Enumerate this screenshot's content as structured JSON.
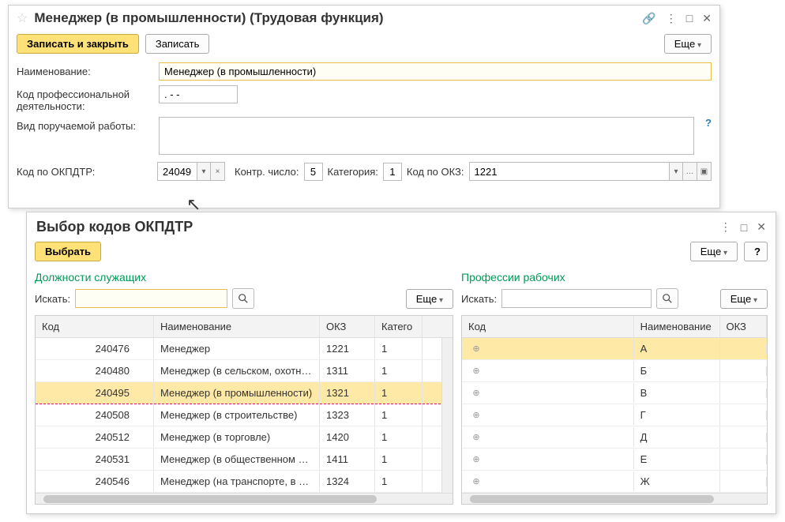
{
  "win1": {
    "title": "Менеджер (в промышленности) (Трудовая функция)",
    "toolbar": {
      "save_close": "Записать и закрыть",
      "save": "Записать",
      "more": "Еще"
    },
    "labels": {
      "name": "Наименование:",
      "code_prof": "Код профессиональной деятельности:",
      "work_type": "Вид поручаемой работы:",
      "okpdtr": "Код по ОКПДТР:",
      "check_num": "Контр. число:",
      "category": "Категория:",
      "okz": "Код по ОКЗ:"
    },
    "values": {
      "name": "Менеджер (в промышленности)",
      "code_prof": ". - -",
      "okpdtr": "24049",
      "check_num": "5",
      "category": "1",
      "okz": "1221"
    }
  },
  "win2": {
    "title": "Выбор кодов ОКПДТР",
    "toolbar": {
      "select": "Выбрать",
      "more": "Еще",
      "help": "?"
    },
    "left": {
      "title": "Должности служащих",
      "search_label": "Искать:",
      "more": "Еще",
      "columns": {
        "code": "Код",
        "name": "Наименование",
        "okz": "ОКЗ",
        "cat": "Катего"
      },
      "rows": [
        {
          "code": "240476",
          "name": "Менеджер",
          "okz": "1221",
          "cat": "1",
          "sel": false
        },
        {
          "code": "240480",
          "name": "Менеджер (в сельском, охотнич...",
          "okz": "1311",
          "cat": "1",
          "sel": false
        },
        {
          "code": "240495",
          "name": "Менеджер (в промышленности)",
          "okz": "1321",
          "cat": "1",
          "sel": true
        },
        {
          "code": "240508",
          "name": "Менеджер (в строительстве)",
          "okz": "1323",
          "cat": "1",
          "sel": false
        },
        {
          "code": "240512",
          "name": "Менеджер (в торговле)",
          "okz": "1420",
          "cat": "1",
          "sel": false
        },
        {
          "code": "240531",
          "name": "Менеджер (в общественном пит...",
          "okz": "1411",
          "cat": "1",
          "sel": false
        },
        {
          "code": "240546",
          "name": "Менеджер (на транспорте, в свя...",
          "okz": "1324",
          "cat": "1",
          "sel": false
        }
      ]
    },
    "right": {
      "title": "Профессии рабочих",
      "search_label": "Искать:",
      "more": "Еще",
      "columns": {
        "code": "Код",
        "name": "Наименование",
        "okz": "ОКЗ"
      },
      "rows": [
        {
          "name": "А",
          "sel": true
        },
        {
          "name": "Б",
          "sel": false
        },
        {
          "name": "В",
          "sel": false
        },
        {
          "name": "Г",
          "sel": false
        },
        {
          "name": "Д",
          "sel": false
        },
        {
          "name": "Е",
          "sel": false
        },
        {
          "name": "Ж",
          "sel": false
        }
      ]
    }
  }
}
